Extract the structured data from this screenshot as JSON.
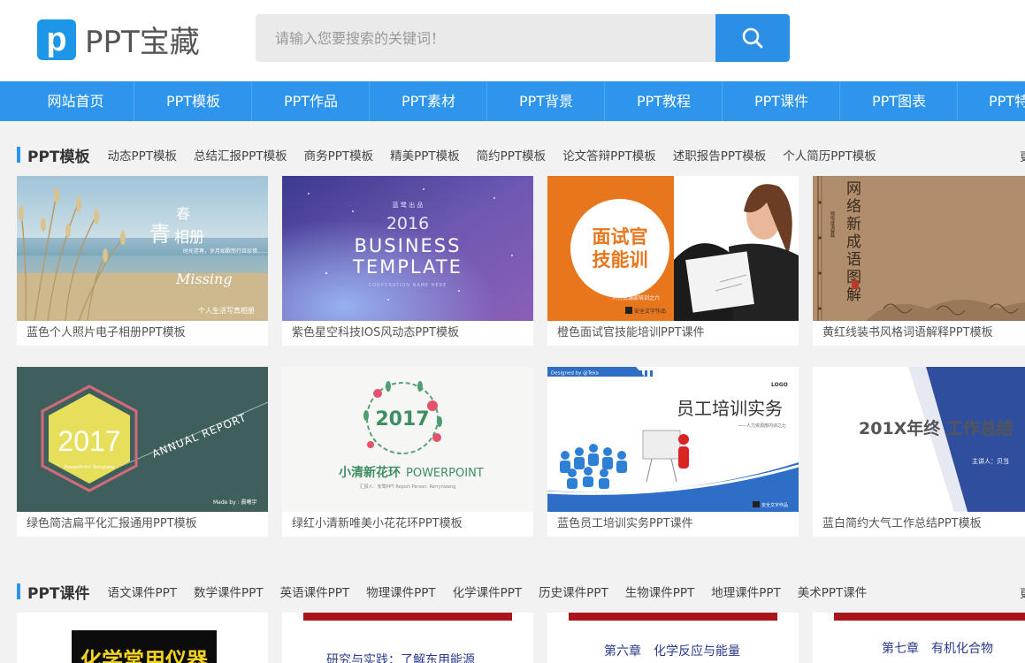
{
  "logo": {
    "mark": "p",
    "text": "PPT宝藏"
  },
  "search": {
    "placeholder": "请输入您要搜索的关键词！"
  },
  "nav": [
    "网站首页",
    "PPT模板",
    "PPT作品",
    "PPT素材",
    "PPT背景",
    "PPT教程",
    "PPT课件",
    "PPT图表",
    "PPT特"
  ],
  "section1": {
    "title": "PPT模板",
    "links": [
      "动态PPT模板",
      "总结汇报PPT模板",
      "商务PPT模板",
      "精美PPT模板",
      "简约PPT模板",
      "论文答辩PPT模板",
      "述职报告PPT模板",
      "个人简历PPT模板"
    ],
    "more": "更",
    "cards": [
      {
        "caption": "蓝色个人照片电子相册PPT模板",
        "t1": "青",
        "t2": "春",
        "t3": "相册",
        "t4": "Missing",
        "t5": "个人生活写真相册",
        "t6": "时光荏苒，岁月如歌而行且珍惜……"
      },
      {
        "caption": "紫色星空科技IOS风动态PPT模板",
        "t1": "蓝 鹭 出 品",
        "t2": "2016",
        "t3": "BUSINESS",
        "t4": "TEMPLATE",
        "t5": "CORPORATION NAME HERE"
      },
      {
        "caption": "橙色面试官技能培训PPT课件",
        "t1": "面试官",
        "t2": "技能训",
        "t3": "人力资源部培训之六",
        "t4": "安全文字作品"
      },
      {
        "caption": "黄红线装书风格词语解释PPT模板",
        "t1": "网络新成语图解",
        "t2": "网络成语解释"
      },
      {
        "caption": "绿色简洁扁平化汇报通用PPT模板",
        "t1": "2017",
        "t2": "PowerPoint Template",
        "t3": "ANNUAL REPORT",
        "t4": "Made by : 晨曦宇"
      },
      {
        "caption": "绿红小清新唯美小花花环PPT模板",
        "t1": "2017",
        "t2": "小清新花环",
        "t3": "POWERPOINT",
        "t4": "汇报人：安鹭PPT  Report Person: Kerrynwang"
      },
      {
        "caption": "蓝色员工培训实务PPT课件",
        "t1": "Designed by @Teka",
        "t2": "LOGO",
        "t3": "员工培训实务",
        "t4": "——人力资源部内训之七",
        "t5": "安全文字作品"
      },
      {
        "caption": "蓝白简约大气工作总结PPT模板",
        "t1": "201X年终 工作总结",
        "t2": "主讲人：贝当"
      }
    ]
  },
  "section2": {
    "title": "PPT课件",
    "links": [
      "语文课件PPT",
      "数学课件PPT",
      "英语课件PPT",
      "物理课件PPT",
      "化学课件PPT",
      "历史课件PPT",
      "生物课件PPT",
      "地理课件PPT",
      "美术PPT课件"
    ],
    "more": "更",
    "cards": [
      {
        "t1": "化学常用仪器"
      },
      {
        "t1": "研究与实践：了解东用能源"
      },
      {
        "t1": "第六章　化学反应与能量"
      },
      {
        "t1": "第七章　有机化合物"
      }
    ]
  },
  "colors": {
    "accent": "#2d95eb",
    "nav_bg": "#2d95eb",
    "logo": "#1c97e8"
  },
  "icons": {
    "search": "search-icon"
  }
}
